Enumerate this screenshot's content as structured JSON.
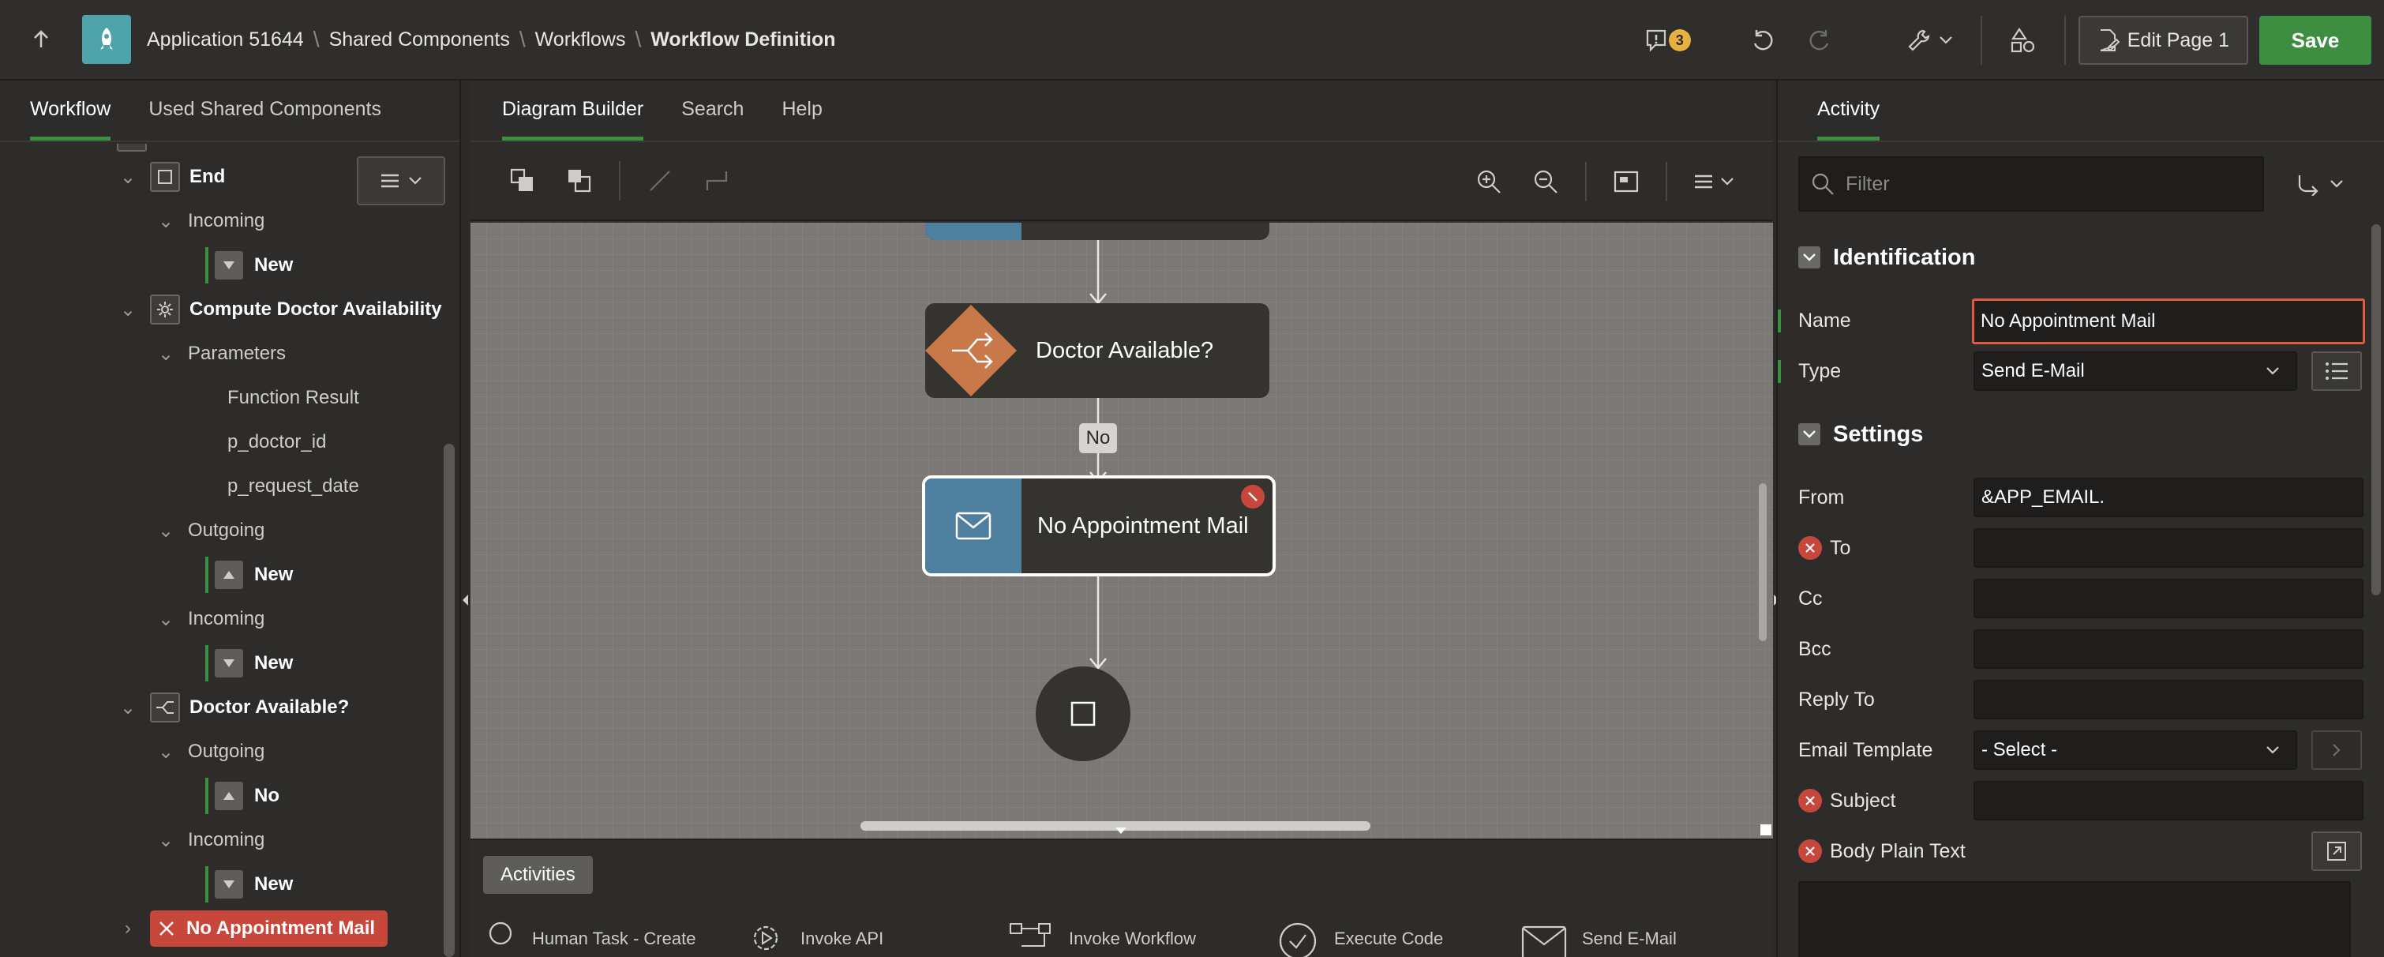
{
  "header": {
    "breadcrumbs": [
      "Application 51644",
      "Shared Components",
      "Workflows",
      "Workflow Definition"
    ],
    "notifications_count": "3",
    "edit_page_label": "Edit Page 1",
    "save_label": "Save"
  },
  "left_panel": {
    "tabs": [
      {
        "label": "Workflow"
      },
      {
        "label": "Used Shared Components"
      }
    ],
    "tree": {
      "end": "End",
      "end_incoming": "Incoming",
      "end_incoming_new": "New",
      "compute": "Compute Doctor Availability",
      "parameters": "Parameters",
      "param1": "Function Result",
      "param2": "p_doctor_id",
      "param3": "p_request_date",
      "compute_outgoing": "Outgoing",
      "compute_outgoing_new": "New",
      "compute_incoming": "Incoming",
      "compute_incoming_new": "New",
      "doctor": "Doctor Available?",
      "doctor_outgoing": "Outgoing",
      "doctor_outgoing_no": "No",
      "doctor_incoming": "Incoming",
      "doctor_incoming_new": "New",
      "selected": "No Appointment Mail"
    }
  },
  "center": {
    "tabs": [
      {
        "label": "Diagram Builder"
      },
      {
        "label": "Search"
      },
      {
        "label": "Help"
      }
    ],
    "diagram": {
      "switch_label": "Doctor Available?",
      "connector_label": "No",
      "mail_label": "No Appointment Mail"
    },
    "activities": {
      "label": "Activities",
      "items": [
        "Human Task - Create",
        "Invoke API",
        "Invoke Workflow",
        "Execute Code",
        "Send E-Mail"
      ]
    }
  },
  "right_panel": {
    "tab": "Activity",
    "filter_placeholder": "Filter",
    "identification": {
      "title": "Identification",
      "name_label": "Name",
      "name_value": "No Appointment Mail",
      "type_label": "Type",
      "type_value": "Send E-Mail"
    },
    "settings": {
      "title": "Settings",
      "from_label": "From",
      "from_value": "&APP_EMAIL.",
      "to_label": "To",
      "cc_label": "Cc",
      "bcc_label": "Bcc",
      "reply_to_label": "Reply To",
      "template_label": "Email Template",
      "template_value": "- Select -",
      "subject_label": "Subject",
      "body_label": "Body Plain Text"
    }
  },
  "colors": {
    "accent_green": "#3e8e41",
    "error_red": "#c7473b",
    "switch_orange": "#c9784a",
    "mail_blue": "#4f7f9e",
    "app_teal": "#4fa3aa"
  }
}
